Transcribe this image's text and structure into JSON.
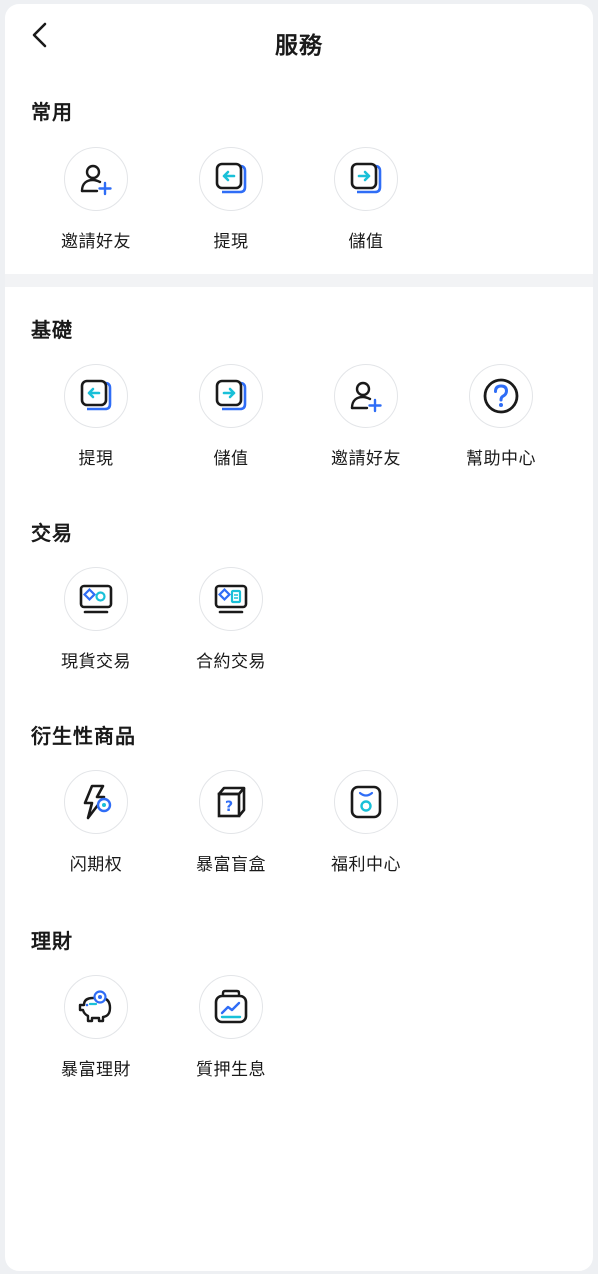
{
  "header": {
    "title": "服務",
    "back_icon": "chevron-left-icon"
  },
  "colors": {
    "accent_blue": "#2f6df6",
    "accent_cyan": "#19c0d8",
    "text": "#1a1a1a",
    "divider": "#f2f3f5"
  },
  "sections": [
    {
      "title": "常用",
      "items": [
        {
          "label": "邀請好友",
          "icon": "invite-friend-icon"
        },
        {
          "label": "提現",
          "icon": "withdraw-icon"
        },
        {
          "label": "儲值",
          "icon": "deposit-icon"
        }
      ]
    },
    {
      "title": "基礎",
      "items": [
        {
          "label": "提現",
          "icon": "withdraw-icon"
        },
        {
          "label": "儲值",
          "icon": "deposit-icon"
        },
        {
          "label": "邀請好友",
          "icon": "invite-friend-icon"
        },
        {
          "label": "幫助中心",
          "icon": "help-center-icon"
        }
      ]
    },
    {
      "title": "交易",
      "items": [
        {
          "label": "現貨交易",
          "icon": "spot-trading-icon"
        },
        {
          "label": "合約交易",
          "icon": "contract-trading-icon"
        }
      ]
    },
    {
      "title": "衍生性商品",
      "items": [
        {
          "label": "闪期权",
          "icon": "flash-options-icon"
        },
        {
          "label": "暴富盲盒",
          "icon": "mystery-box-icon"
        },
        {
          "label": "福利中心",
          "icon": "welfare-center-icon"
        }
      ]
    },
    {
      "title": "理財",
      "items": [
        {
          "label": "暴富理財",
          "icon": "piggy-bank-icon"
        },
        {
          "label": "質押生息",
          "icon": "staking-icon"
        }
      ]
    }
  ]
}
